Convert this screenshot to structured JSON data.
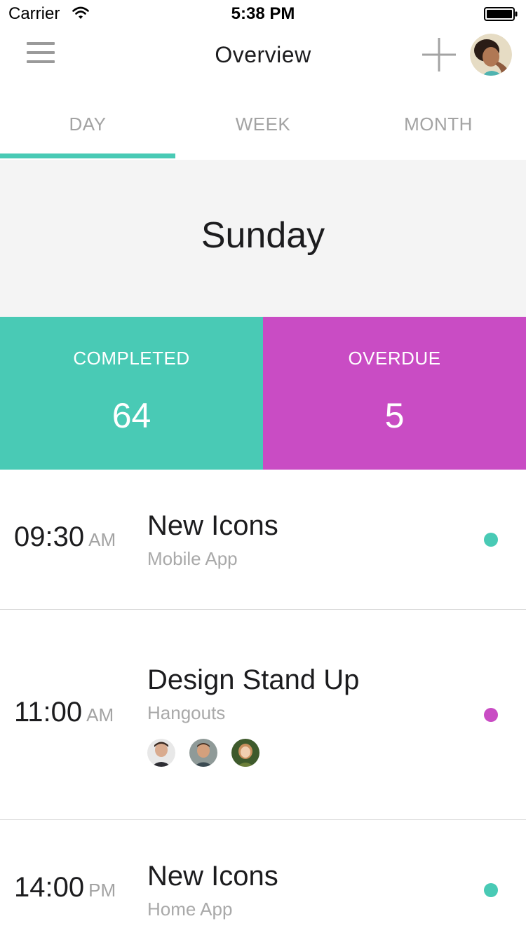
{
  "status_bar": {
    "carrier": "Carrier",
    "time": "5:38 PM",
    "icons": [
      "wifi-icon",
      "battery-icon"
    ]
  },
  "nav": {
    "title": "Overview",
    "menu_icon": "hamburger-menu-icon",
    "add_icon": "plus-icon",
    "avatar_icon": "user-avatar"
  },
  "tabs": [
    {
      "label": "DAY",
      "active": true
    },
    {
      "label": "WEEK",
      "active": false
    },
    {
      "label": "MONTH",
      "active": false
    }
  ],
  "day": {
    "name": "Sunday"
  },
  "stats": {
    "completed": {
      "label": "COMPLETED",
      "value": "64",
      "color": "#49cab5"
    },
    "overdue": {
      "label": "OVERDUE",
      "value": "5",
      "color": "#c94cc4"
    }
  },
  "events": [
    {
      "time": "09:30",
      "ampm": "AM",
      "title": "New Icons",
      "subtitle": "Mobile App",
      "dot_color": "#49cab5",
      "attendees": []
    },
    {
      "time": "11:00",
      "ampm": "AM",
      "title": "Design Stand Up",
      "subtitle": "Hangouts",
      "dot_color": "#c94cc4",
      "attendees": [
        "attendee-avatar-1",
        "attendee-avatar-2",
        "attendee-avatar-3"
      ]
    },
    {
      "time": "14:00",
      "ampm": "PM",
      "title": "New Icons",
      "subtitle": "Home App",
      "dot_color": "#49cab5",
      "attendees": []
    }
  ],
  "colors": {
    "accent_teal": "#49cab5",
    "accent_magenta": "#c94cc4",
    "header_bg": "#f4f4f4"
  }
}
